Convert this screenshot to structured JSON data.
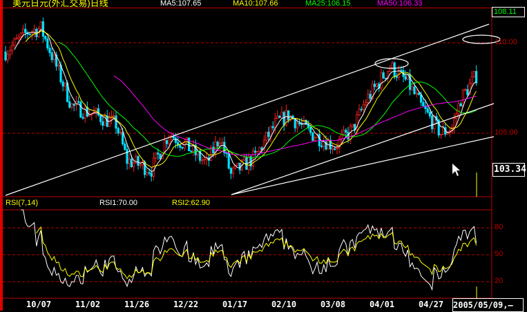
{
  "header": {
    "title": "美元日元(外汇交易)日线",
    "ma5": "MA5:107.65",
    "ma10": "MA10:107.66",
    "ma25": "MA25:106.15",
    "ma50": "MA50:106.33"
  },
  "price_axis": {
    "current_high": "108.11",
    "labels": [
      "110.00",
      "105.00"
    ],
    "current_price": "103.34"
  },
  "rsi_panel": {
    "title": "RSI(7,14)",
    "rsi1": "RSI1:70.00",
    "rsi2": "RSI2:62.90",
    "levels": [
      "80",
      "50",
      "20"
    ]
  },
  "date_axis": {
    "labels": [
      "10/07",
      "11/02",
      "11/26",
      "12/22",
      "01/17",
      "02/10",
      "03/08",
      "04/01",
      "04/27"
    ],
    "cursor_date": "2005/05/09,—"
  },
  "colors": {
    "up": "#ff2020",
    "down": "#00e0ff",
    "ma5": "#ffffff",
    "ma10": "#ffff00",
    "ma25": "#00ff00",
    "ma50": "#ff00ff",
    "grid": "#c00000"
  },
  "chart_data": {
    "type": "candlestick",
    "days": 214,
    "price_path": [
      [
        0,
        109.5
      ],
      [
        10,
        110.6
      ],
      [
        16,
        110.8
      ],
      [
        22,
        109
      ],
      [
        30,
        106.5
      ],
      [
        41,
        106
      ],
      [
        50,
        105.5
      ],
      [
        55,
        103.5
      ],
      [
        66,
        103
      ],
      [
        74,
        105
      ],
      [
        82,
        104.3
      ],
      [
        91,
        103.3
      ],
      [
        97,
        104.8
      ],
      [
        102,
        102.7
      ],
      [
        113,
        103.7
      ],
      [
        122,
        105.5
      ],
      [
        128,
        106
      ],
      [
        138,
        105
      ],
      [
        149,
        104.3
      ],
      [
        157,
        105.2
      ],
      [
        163,
        106.8
      ],
      [
        174,
        108.7
      ],
      [
        182,
        107.8
      ],
      [
        188,
        106.5
      ],
      [
        197,
        105
      ],
      [
        202,
        105.3
      ],
      [
        206,
        106.9
      ],
      [
        213,
        108.2
      ]
    ],
    "ylim": [
      101.5,
      111.75
    ],
    "rsi_ylim": [
      0,
      100
    ],
    "moving_averages": [
      5,
      10,
      25,
      50
    ],
    "rsi_periods": [
      7,
      14
    ]
  }
}
